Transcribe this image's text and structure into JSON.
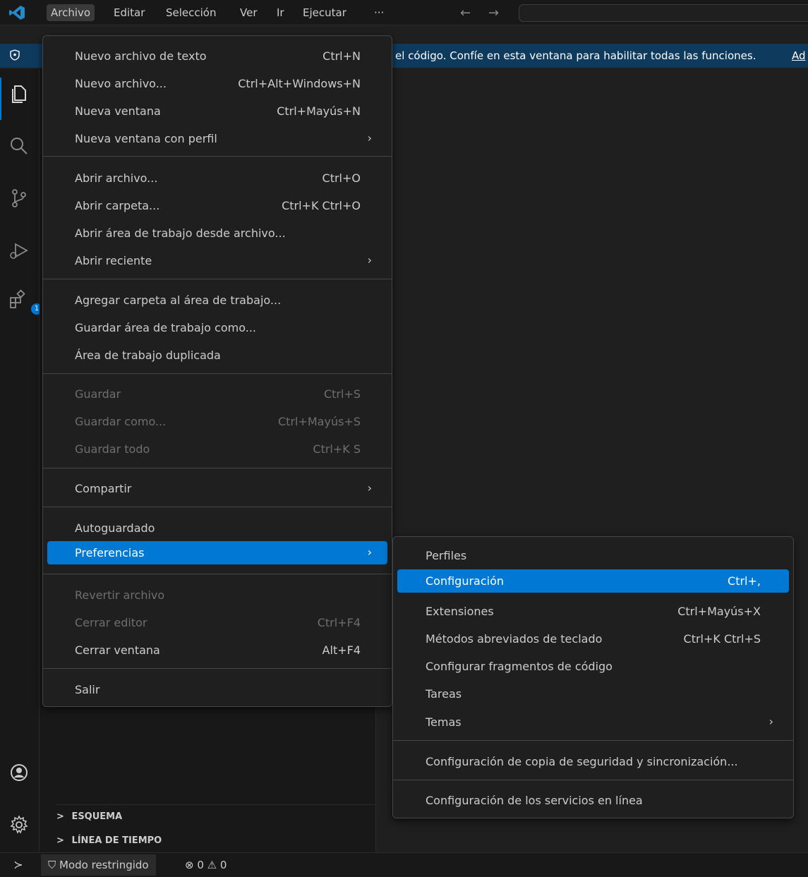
{
  "menubar": {
    "items": [
      {
        "label": "Archivo",
        "active": true
      },
      {
        "label": "Editar"
      },
      {
        "label": "Selección"
      },
      {
        "label": "Ver"
      },
      {
        "label": "Ir"
      },
      {
        "label": "Ejecutar"
      },
      {
        "label": "···"
      }
    ],
    "back": "←",
    "forward": "→"
  },
  "banner": {
    "text": "el código. Confíe en esta ventana para habilitar todas las funciones.",
    "link": "Ad"
  },
  "activitybar": {
    "extensions_badge": "1"
  },
  "sidebar": {
    "outline": "ESQUEMA",
    "timeline": "LÍNEA DE TIEMPO",
    "chevron": ">"
  },
  "statusbar": {
    "remote": "≻",
    "restricted": "Modo restringido",
    "problems": "⊗ 0 ⚠ 0"
  },
  "file_menu": {
    "items": [
      {
        "label": "Nuevo archivo de texto",
        "shortcut": "Ctrl+N"
      },
      {
        "label": "Nuevo archivo...",
        "shortcut": "Ctrl+Alt+Windows+N"
      },
      {
        "label": "Nueva ventana",
        "shortcut": "Ctrl+Mayús+N"
      },
      {
        "label": "Nueva ventana con perfil",
        "submenu": true
      },
      {
        "label": "Abrir archivo...",
        "shortcut": "Ctrl+O"
      },
      {
        "label": "Abrir carpeta...",
        "shortcut": "Ctrl+K Ctrl+O"
      },
      {
        "label": "Abrir área de trabajo desde archivo..."
      },
      {
        "label": "Abrir reciente",
        "submenu": true
      },
      {
        "label": "Agregar carpeta al área de trabajo..."
      },
      {
        "label": "Guardar área de trabajo como..."
      },
      {
        "label": "Área de trabajo duplicada"
      },
      {
        "label": "Guardar",
        "shortcut": "Ctrl+S",
        "disabled": true
      },
      {
        "label": "Guardar como...",
        "shortcut": "Ctrl+Mayús+S",
        "disabled": true
      },
      {
        "label": "Guardar todo",
        "shortcut": "Ctrl+K S",
        "disabled": true
      },
      {
        "label": "Compartir",
        "submenu": true
      },
      {
        "label": "Autoguardado"
      },
      {
        "label": "Preferencias",
        "submenu": true,
        "selected": true
      },
      {
        "label": "Revertir archivo",
        "disabled": true
      },
      {
        "label": "Cerrar editor",
        "shortcut": "Ctrl+F4",
        "disabled": true
      },
      {
        "label": "Cerrar ventana",
        "shortcut": "Alt+F4"
      },
      {
        "label": "Salir"
      }
    ]
  },
  "pref_menu": {
    "items": [
      {
        "label": "Perfiles"
      },
      {
        "label": "Configuración",
        "shortcut": "Ctrl+,",
        "selected": true
      },
      {
        "label": "Extensiones",
        "shortcut": "Ctrl+Mayús+X"
      },
      {
        "label": "Métodos abreviados de teclado",
        "shortcut": "Ctrl+K Ctrl+S"
      },
      {
        "label": "Configurar fragmentos de código"
      },
      {
        "label": "Tareas"
      },
      {
        "label": "Temas",
        "submenu": true
      },
      {
        "label": "Configuración de copia de seguridad y sincronización..."
      },
      {
        "label": "Configuración de los servicios en línea"
      }
    ]
  },
  "colors": {
    "accent": "#0078d4",
    "banner": "#0e3a5e",
    "menu_bg": "#1f1f1f",
    "disabled_text": "#6e6e6e"
  }
}
